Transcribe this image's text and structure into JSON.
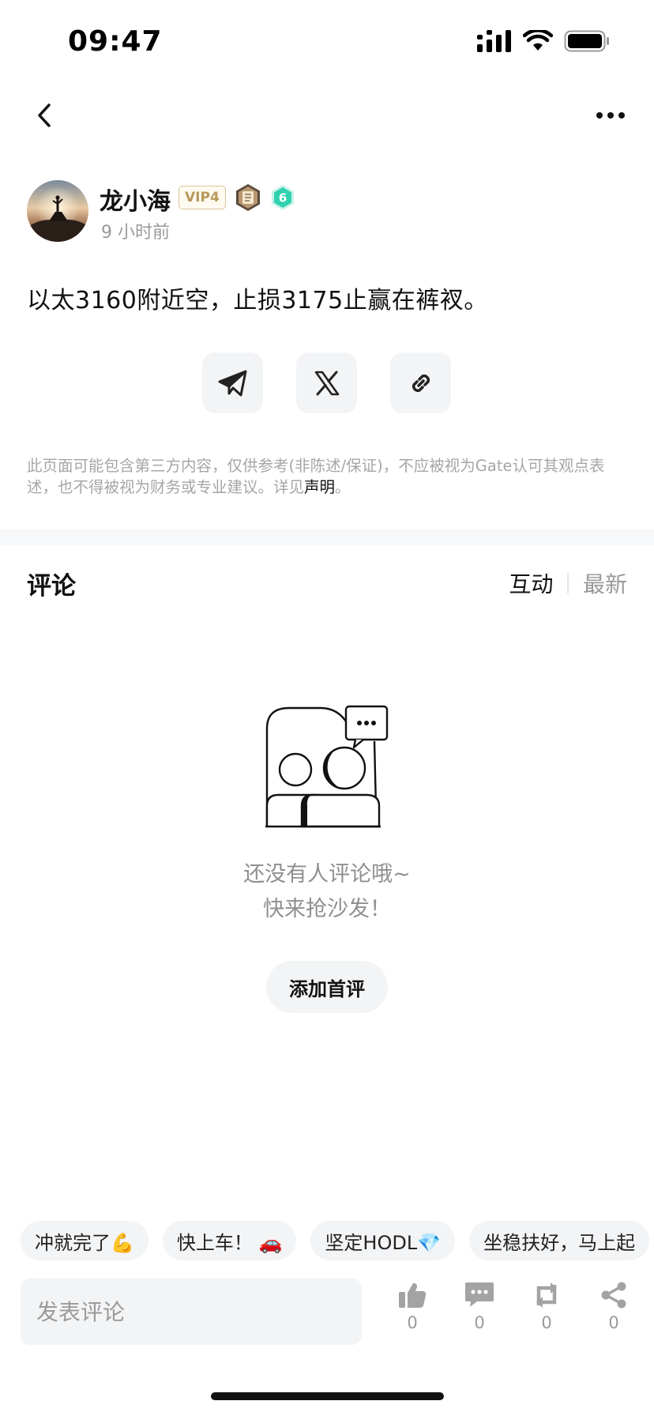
{
  "status_bar": {
    "time": "09:47"
  },
  "post": {
    "author": "龙小海",
    "vip": "VIP4",
    "level": "6",
    "time_ago": "9 小时前",
    "content": "以太3160附近空，止损3175止赢在裤衩。"
  },
  "share": {
    "icons": [
      "telegram-icon",
      "x-icon",
      "link-icon"
    ]
  },
  "disclaimer": {
    "text": "此页面可能包含第三方内容，仅供参考(非陈述/保证)，不应被视为Gate认可其观点表述，也不得被视为财务或专业建议。详见",
    "link": "声明",
    "end": "。"
  },
  "comments": {
    "title": "评论",
    "tabs": [
      "互动",
      "最新"
    ],
    "empty_line1": "还没有人评论哦~",
    "empty_line2": "快来抢沙发！",
    "add_first": "添加首评"
  },
  "quick_replies": [
    "冲就完了💪",
    "快上车！ 🚗",
    "坚定HODL💎",
    "坐稳扶好，马上起"
  ],
  "bottom_bar": {
    "placeholder": "发表评论",
    "likes": "0",
    "comments": "0",
    "reposts": "0",
    "shares": "0"
  },
  "colors": {
    "accent": "#111111",
    "muted": "#9a9a9a",
    "surface": "#f3f4f6",
    "level_badge": "#2fd1b0",
    "vip_gold": "#b8995a"
  }
}
